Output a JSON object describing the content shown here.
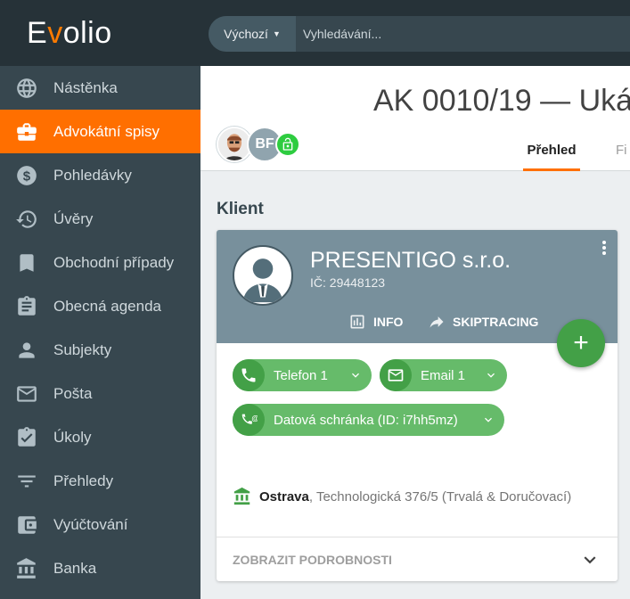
{
  "app": {
    "logo_prefix": "E",
    "logo_accent": "v",
    "logo_suffix": "olio"
  },
  "search": {
    "scope_label": "Výchozí",
    "placeholder": "Vyhledávání..."
  },
  "sidebar": {
    "items": [
      {
        "label": "Nástěnka",
        "icon": "globe-icon"
      },
      {
        "label": "Advokátní spisy",
        "icon": "briefcase-icon",
        "active": true
      },
      {
        "label": "Pohledávky",
        "icon": "dollar-icon"
      },
      {
        "label": "Úvěry",
        "icon": "history-icon"
      },
      {
        "label": "Obchodní případy",
        "icon": "bookmark-icon"
      },
      {
        "label": "Obecná agenda",
        "icon": "clipboard-icon"
      },
      {
        "label": "Subjekty",
        "icon": "person-icon"
      },
      {
        "label": "Pošta",
        "icon": "mail-icon"
      },
      {
        "label": "Úkoly",
        "icon": "task-icon"
      },
      {
        "label": "Přehledy",
        "icon": "filter-icon"
      },
      {
        "label": "Vyúčtování",
        "icon": "wallet-icon"
      },
      {
        "label": "Banka",
        "icon": "bank-icon"
      }
    ]
  },
  "header": {
    "title": "AK 0010/19 — Uká",
    "avatar_initials": "BF",
    "tabs": [
      {
        "label": "Přehled",
        "active": true
      },
      {
        "label": "Fi"
      }
    ]
  },
  "section": {
    "title": "Klient"
  },
  "client": {
    "name": "PRESENTIGO s.r.o.",
    "ic": "IČ: 29448123",
    "actions": {
      "info": "INFO",
      "skiptracing": "SKIPTRACING"
    },
    "fab_label": "+",
    "contacts": {
      "phone": "Telefon 1",
      "email": "Email 1",
      "databox": "Datová schránka (ID: i7hh5mz)"
    },
    "address": {
      "city": "Ostrava",
      "rest": ", Technologická 376/5 (Trvalá & Doručovací)"
    },
    "details_toggle": "ZOBRAZIT PODROBNOSTI"
  },
  "colors": {
    "accent": "#ff6f00",
    "sidebar": "#37474f",
    "topbar": "#263238",
    "card_header": "#78909c",
    "chip_green": "#66bb6a",
    "fab_green": "#43a047"
  }
}
